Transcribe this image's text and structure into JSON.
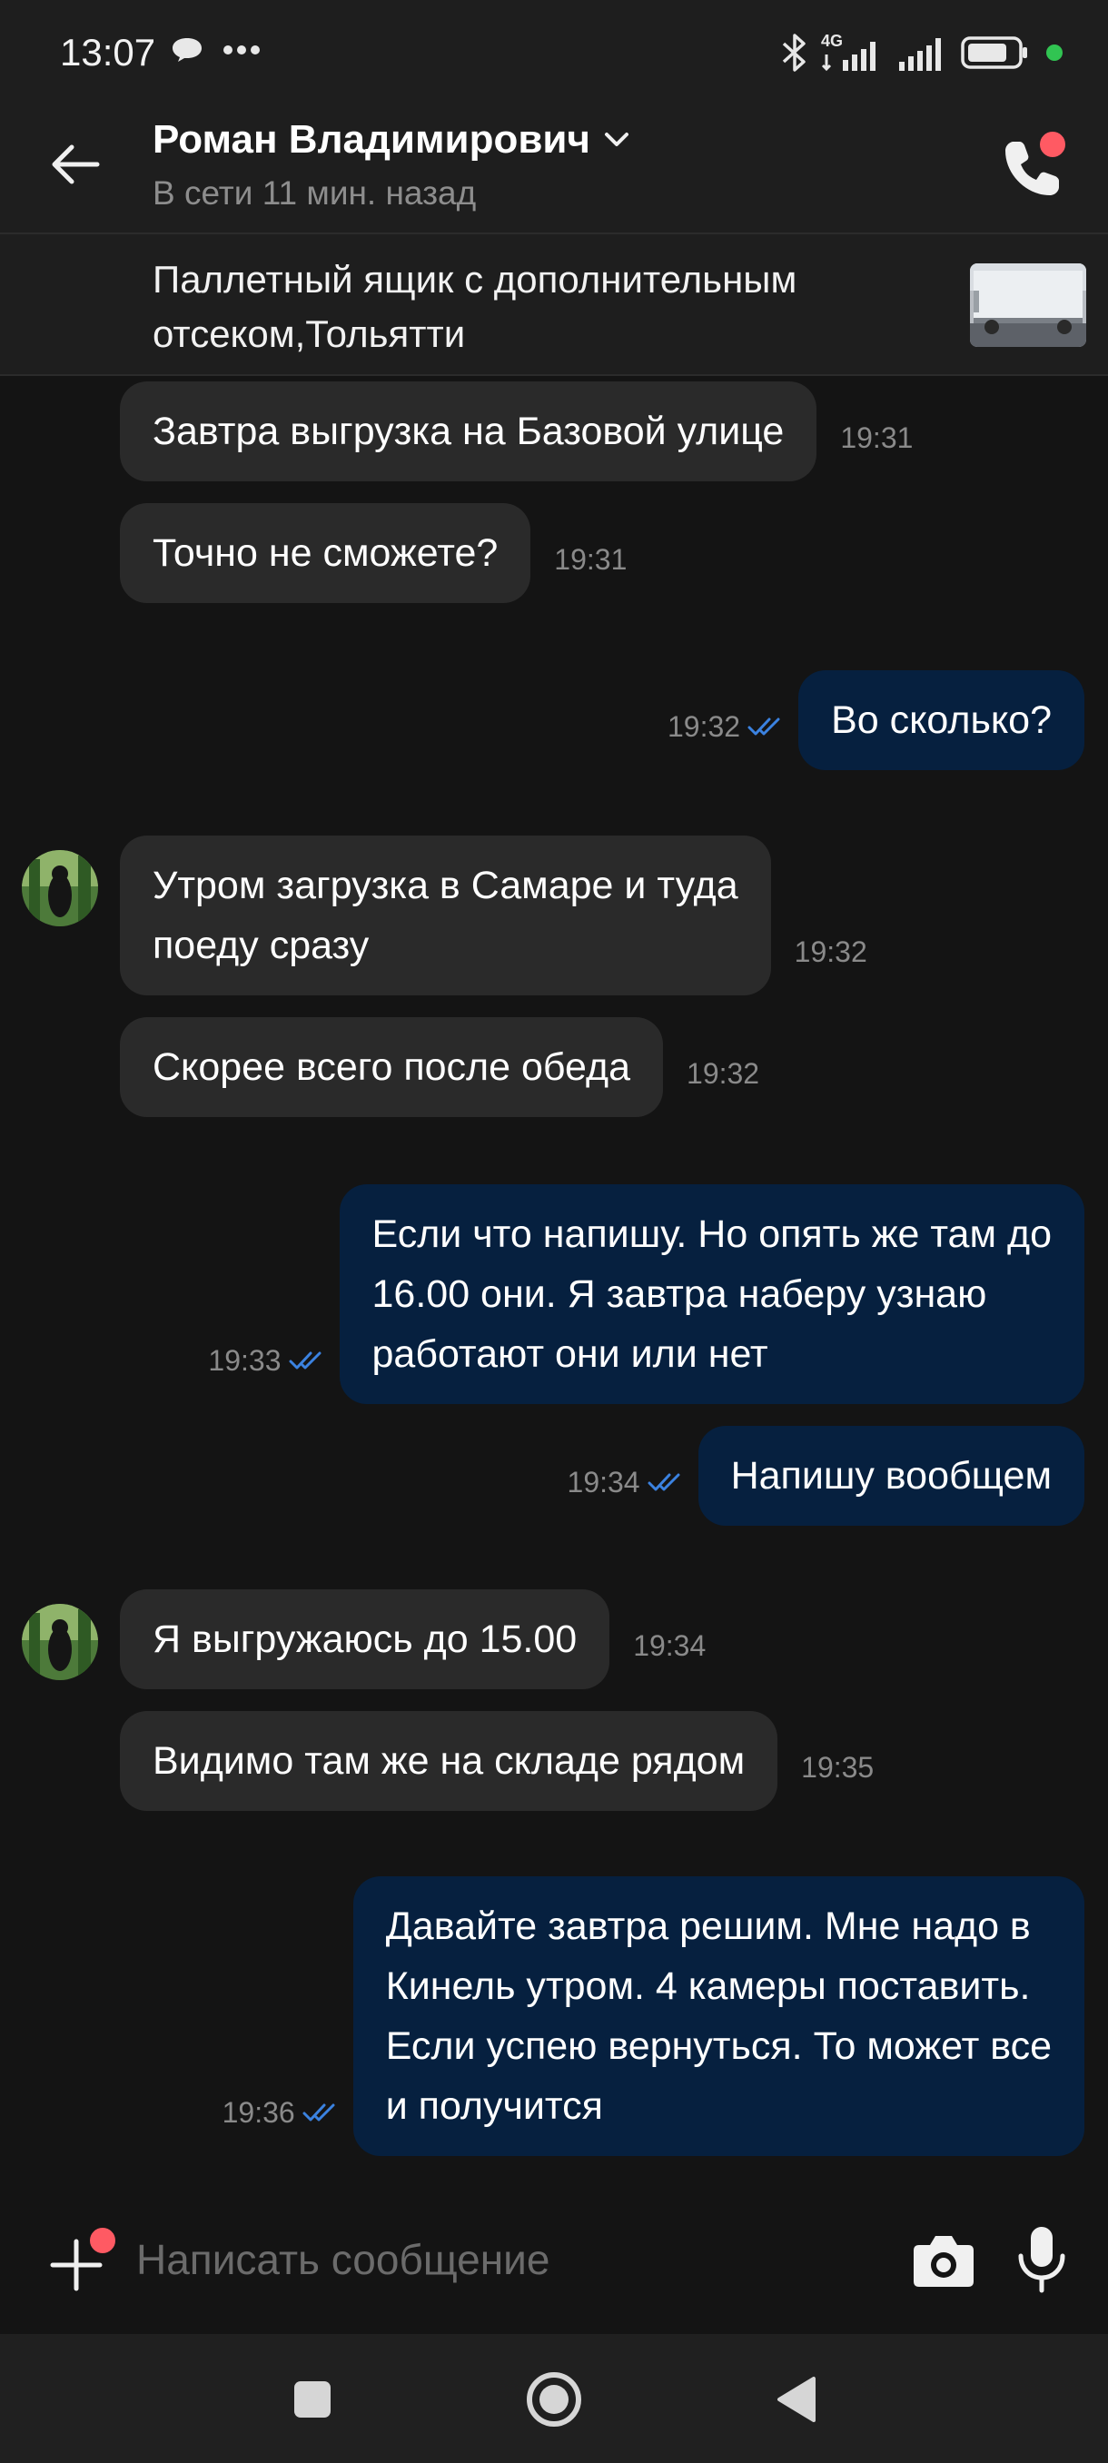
{
  "status_bar": {
    "time": "13:07",
    "network": "4G",
    "battery_level": 0.8
  },
  "header": {
    "contact_name": "Роман Владимирович",
    "contact_status": "В сети 11 мин. назад"
  },
  "listing": {
    "title": "Паллетный ящик с дополнительным отсеком,Тольятти"
  },
  "messages": [
    {
      "direction": "in",
      "text": "Завтра выгрузка на Базовой улице",
      "time": "19:31"
    },
    {
      "direction": "in",
      "text": "Точно не сможете?",
      "time": "19:31"
    },
    {
      "direction": "out",
      "text": "Во сколько?",
      "time": "19:32"
    },
    {
      "direction": "in",
      "text": "Утром загрузка в Самаре и туда\nпоеду сразу",
      "time": "19:32"
    },
    {
      "direction": "in",
      "text": "Скорее всего после обеда",
      "time": "19:32"
    },
    {
      "direction": "out",
      "text": "Если что напишу. Но опять же там до\n16.00 они. Я завтра наберу узнаю\nработают они или нет",
      "time": "19:33"
    },
    {
      "direction": "out",
      "text": "Напишу вообщем",
      "time": "19:34"
    },
    {
      "direction": "in",
      "text": "Я выгружаюсь до 15.00",
      "time": "19:34"
    },
    {
      "direction": "in",
      "text": "Видимо там же на складе рядом",
      "time": "19:35"
    },
    {
      "direction": "out",
      "text": "Давайте завтра решим. Мне надо в\nКинель утром. 4 камеры поставить.\nЕсли успею вернуться. То может все\nи получится",
      "time": "19:36"
    }
  ],
  "input": {
    "placeholder": "Написать сообщение"
  },
  "icons": {
    "back": "arrow-left-icon",
    "call": "phone-icon",
    "attach": "plus-icon",
    "camera": "camera-icon",
    "mic": "microphone-icon",
    "read": "double-check-icon",
    "nav_recent": "square-icon",
    "nav_home": "circle-icon",
    "nav_back": "triangle-icon"
  },
  "colors": {
    "background": "#141414",
    "incoming_bubble": "#2a2a2a",
    "outgoing_bubble": "#06203f",
    "read_check": "#3b82e0",
    "notification_dot": "#ff5a63",
    "online_dot": "#31c452"
  }
}
